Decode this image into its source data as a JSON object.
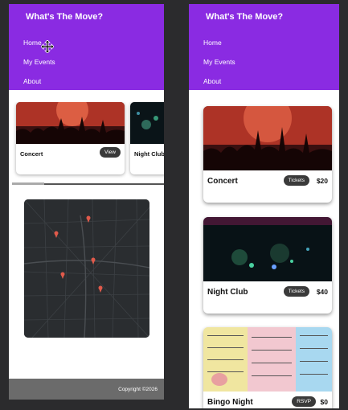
{
  "left": {
    "brand": "What's The Move?",
    "nav": [
      "Home",
      "My Events",
      "About"
    ],
    "cards": [
      {
        "title": "Concert",
        "button": "View"
      },
      {
        "title": "Night Club"
      }
    ],
    "footer": "Copyright ©2026"
  },
  "right": {
    "brand": "What's The Move?",
    "nav": [
      "Home",
      "My Events",
      "About"
    ],
    "cards": [
      {
        "title": "Concert",
        "button": "Tickets",
        "price": "$20"
      },
      {
        "title": "Night Club",
        "button": "Tickets",
        "price": "$40"
      },
      {
        "title": "Bingo Night",
        "button": "RSVP",
        "price": "$0"
      }
    ]
  },
  "colors": {
    "nav": "#8a2be2",
    "pill": "#3a3a3a",
    "footer": "#6b6b6b",
    "map": "#2a2d30",
    "pin": "#e05a4b"
  }
}
